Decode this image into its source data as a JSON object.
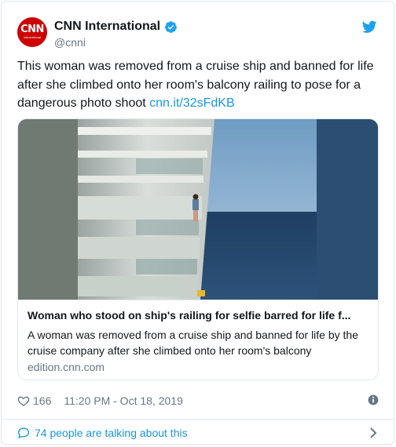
{
  "account": {
    "display_name": "CNN International",
    "handle": "@cnni",
    "avatar_text": "CNN",
    "avatar_subtext": "International",
    "verified": true
  },
  "tweet": {
    "text": "This woman was removed from a cruise ship and banned for life after she climbed onto her room's balcony railing to pose for a dangerous photo shoot ",
    "link": "cnn.it/32sFdKB"
  },
  "card": {
    "title": "Woman who stood on ship's railing for selfie barred for life f...",
    "description": "A woman was removed from a cruise ship and banned for life by the cruise company after she climbed onto her room's balcony",
    "domain": "edition.cnn.com"
  },
  "meta": {
    "likes": "166",
    "timestamp": "11:20 PM - Oct 18, 2019"
  },
  "conversation": {
    "label": "74 people are talking about this"
  },
  "colors": {
    "accent": "#1b95e0",
    "brand_red": "#cc0000",
    "muted": "#657786",
    "border": "#e1e8ed"
  },
  "icons": [
    "verified-icon",
    "twitter-bird-icon",
    "heart-icon",
    "info-icon",
    "speech-bubble-icon",
    "chevron-right-icon"
  ]
}
